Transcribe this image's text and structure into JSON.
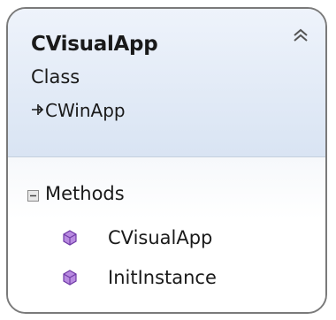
{
  "class_shape": {
    "name": "CVisualApp",
    "kind": "Class",
    "base_class": "CWinApp",
    "collapse_icon": "double-chevron-up-icon",
    "inherit_icon": "inheritance-arrow-icon",
    "sections": [
      {
        "label": "Methods",
        "toggle_icon": "collapse-box-icon",
        "members": [
          {
            "name": "CVisualApp",
            "icon": "method-icon"
          },
          {
            "name": "InitInstance",
            "icon": "method-icon"
          }
        ]
      }
    ]
  },
  "colors": {
    "header_gradient_top": "#eef3fb",
    "header_gradient_bottom": "#d9e4f3",
    "border": "#7a7a7a",
    "method_icon": "#8a4fc4"
  }
}
